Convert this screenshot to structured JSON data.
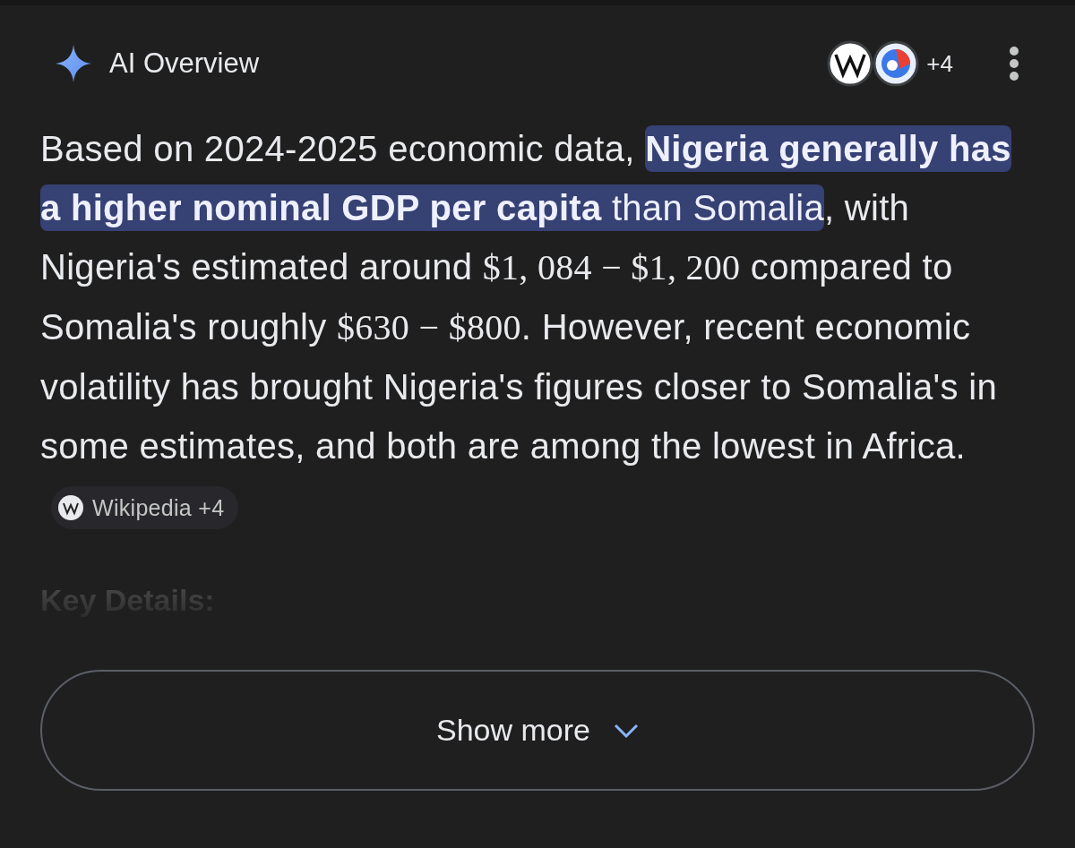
{
  "header": {
    "title": "AI Overview",
    "sources_more": "+4"
  },
  "summary": {
    "segments": [
      {
        "kind": "plain",
        "text": "Based on 2024-2025 economic data, "
      },
      {
        "kind": "highlight",
        "text": "**Nigeria generally has a higher nominal GDP per capita** than Somalia"
      },
      {
        "kind": "plain",
        "text": ", with Nigeria's estimated around "
      },
      {
        "kind": "math",
        "text": "$1, 084 − $1, 200"
      },
      {
        "kind": "plain",
        "text": " compared to Somalia's roughly "
      },
      {
        "kind": "math",
        "text": "$630 − $800"
      },
      {
        "kind": "plain",
        "text": ". However, recent economic volatility has brought Nigeria's figures closer to Somalia's in some estimates, and both are among the lowest in Africa."
      }
    ],
    "citation": "Wikipedia +4"
  },
  "section_heading": "Key Details:",
  "show_more": "Show more"
}
